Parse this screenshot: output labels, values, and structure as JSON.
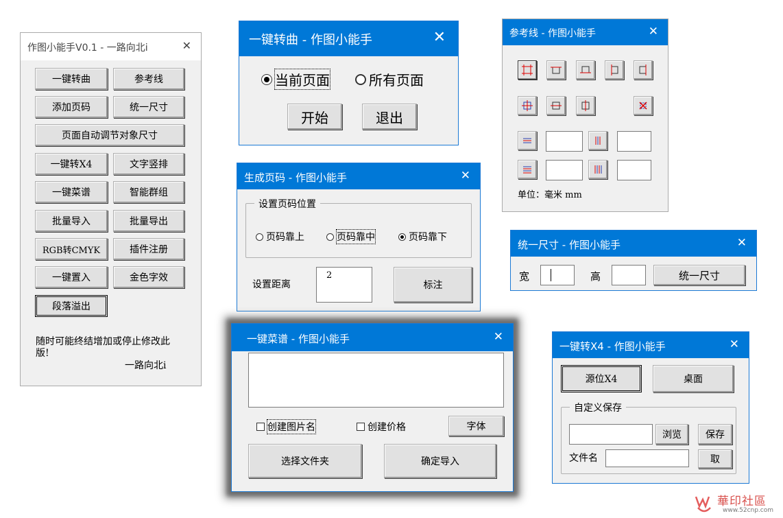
{
  "main": {
    "title": "作图小能手V0.1 - 一路向北i",
    "close": "✕",
    "buttons": [
      "一键转曲",
      "参考线",
      "添加页码",
      "统一尺寸",
      "页面自动调节对象尺寸",
      "一键转X4",
      "文字竖排",
      "一键菜谱",
      "智能群组",
      "批量导入",
      "批量导出",
      "RGB转CMYK",
      "插件注册",
      "一键置入",
      "金色字效",
      "段落溢出"
    ],
    "note": "随时可能终结增加或停止修改此版!",
    "author": "一路向北i"
  },
  "curve": {
    "title": "一键转曲 - 作图小能手",
    "close": "✕",
    "radio_current": "当前页面",
    "radio_all": "所有页面",
    "start": "开始",
    "exit": "退出"
  },
  "pagenum": {
    "title": "生成页码 - 作图小能手",
    "close": "✕",
    "group": "设置页码位置",
    "top": "页码靠上",
    "middle": "页码靠中",
    "bottom": "页码靠下",
    "distance_label": "设置距离",
    "distance_value": "2",
    "mark": "标注"
  },
  "guides": {
    "title": "参考线 - 作图小能手",
    "close": "✕",
    "unit": "单位：毫米 mm"
  },
  "unify": {
    "title": "统一尺寸 - 作图小能手",
    "close": "✕",
    "width_label": "宽",
    "height_label": "高",
    "button": "统一尺寸"
  },
  "menu": {
    "title": "一键菜谱 - 作图小能手",
    "close": "✕",
    "chk_name": "创建图片名",
    "chk_price": "创建价格",
    "font": "字体",
    "select_folder": "选择文件夹",
    "confirm": "确定导入"
  },
  "x4": {
    "title": "一键转X4 - 作图小能手",
    "close": "✕",
    "source": "源位X4",
    "desktop": "桌面",
    "group": "自定义保存",
    "browse": "浏览",
    "save": "保存",
    "filename_label": "文件名",
    "cancel": "取"
  },
  "watermark": {
    "brand": "華印社區",
    "url": "www.52cnp.com"
  },
  "colors": {
    "accent": "#0078d7",
    "dialog_bg": "#f0f0f0",
    "watermark": "#d9534f"
  }
}
